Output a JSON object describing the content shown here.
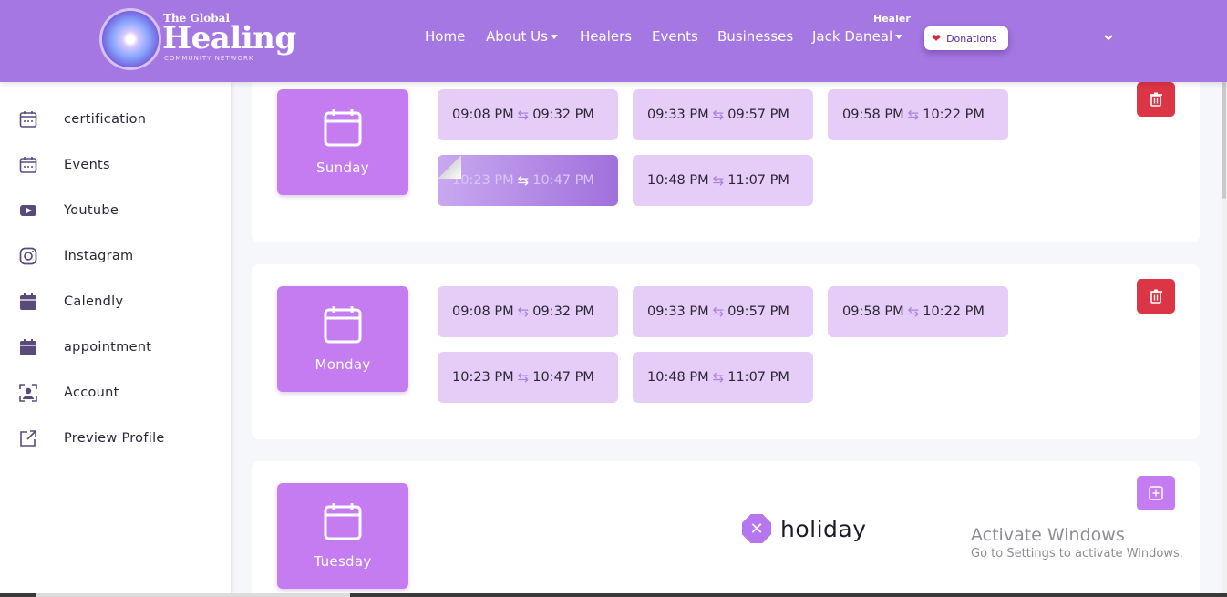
{
  "header": {
    "logo_small": "The Global",
    "logo_big": "Healing",
    "logo_sub": "COMMUNITY NETWORK",
    "nav": {
      "home": "Home",
      "about": "About Us",
      "healers": "Healers",
      "events": "Events",
      "businesses": "Businesses",
      "user": "Jack Daneal"
    },
    "user_role": "Healer",
    "donate_label": "Donations",
    "chevron_icon": "chevron-down-icon"
  },
  "sidebar": {
    "items": [
      {
        "label": "certification",
        "icon": "calendar-dots-icon"
      },
      {
        "label": "Events",
        "icon": "calendar-dots-icon"
      },
      {
        "label": "Youtube",
        "icon": "youtube-icon"
      },
      {
        "label": "Instagram",
        "icon": "instagram-icon"
      },
      {
        "label": "Calendly",
        "icon": "calendar-solid-icon"
      },
      {
        "label": "appointment",
        "icon": "calendar-solid-icon"
      },
      {
        "label": "Account",
        "icon": "account-icon"
      },
      {
        "label": "Preview Profile",
        "icon": "external-link-icon"
      }
    ]
  },
  "schedule": {
    "days": [
      {
        "name": "Sunday",
        "slots": [
          {
            "start": "09:08 PM",
            "end": "09:32 PM"
          },
          {
            "start": "09:33 PM",
            "end": "09:57 PM"
          },
          {
            "start": "09:58 PM",
            "end": "10:22 PM"
          },
          {
            "start": "10:23 PM",
            "end": "10:47 PM"
          },
          {
            "start": "10:48 PM",
            "end": "11:07 PM"
          }
        ],
        "action": "delete"
      },
      {
        "name": "Monday",
        "slots": [
          {
            "start": "09:08 PM",
            "end": "09:32 PM"
          },
          {
            "start": "09:33 PM",
            "end": "09:57 PM"
          },
          {
            "start": "09:58 PM",
            "end": "10:22 PM"
          },
          {
            "start": "10:23 PM",
            "end": "10:47 PM"
          },
          {
            "start": "10:48 PM",
            "end": "11:07 PM"
          }
        ],
        "action": "delete"
      },
      {
        "name": "Tuesday",
        "holiday_label": "holiday",
        "action": "add"
      }
    ]
  },
  "watermark": {
    "title": "Activate Windows",
    "subtitle": "Go to Settings to activate Windows."
  },
  "colors": {
    "header": "#a577e3",
    "day_box": "#c47cf0",
    "slot": "#e6cdf7",
    "delete": "#dc3545"
  }
}
